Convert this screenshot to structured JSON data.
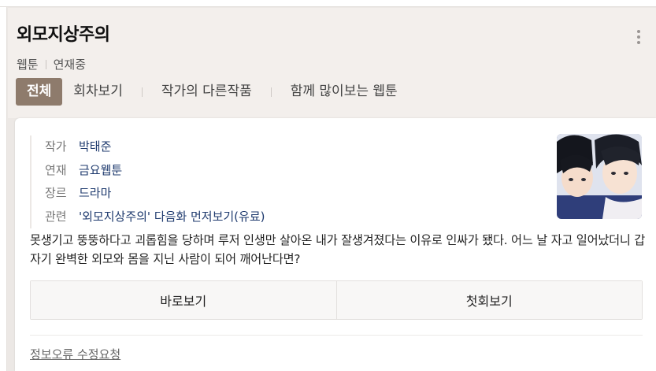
{
  "header": {
    "title": "외모지상주의",
    "meta": [
      "웹툰",
      "연재중"
    ],
    "tabs": [
      {
        "label": "전체",
        "active": true
      },
      {
        "label": "회차보기",
        "active": false
      },
      {
        "label": "작가의 다른작품",
        "active": false
      },
      {
        "label": "함께 많이보는 웹툰",
        "active": false
      }
    ]
  },
  "info": [
    {
      "label": "작가",
      "value": "박태준"
    },
    {
      "label": "연재",
      "value": "금요웹툰"
    },
    {
      "label": "장르",
      "value": "드라마"
    },
    {
      "label": "관련",
      "value": "'외모지상주의' 다음화 먼저보기(유료)"
    }
  ],
  "summary": "못생기고 뚱뚱하다고 괴롭힘을 당하며 루저 인생만 살아온 내가 잘생겨졌다는 이유로 인싸가 됐다. 어느 날 자고 일어났더니 갑자기 완벽한 외모와 몸을 지닌 사람이 되어 깨어난다면?",
  "buttons": {
    "read": "바로보기",
    "first": "첫회보기"
  },
  "report_link": "정보오류 수정요청",
  "colors": {
    "active_tab_bg": "#8e7b6c",
    "link_text": "#1e3a6e",
    "header_bg": "#f3efec"
  },
  "icons": {
    "more": "more-vertical-icon"
  }
}
